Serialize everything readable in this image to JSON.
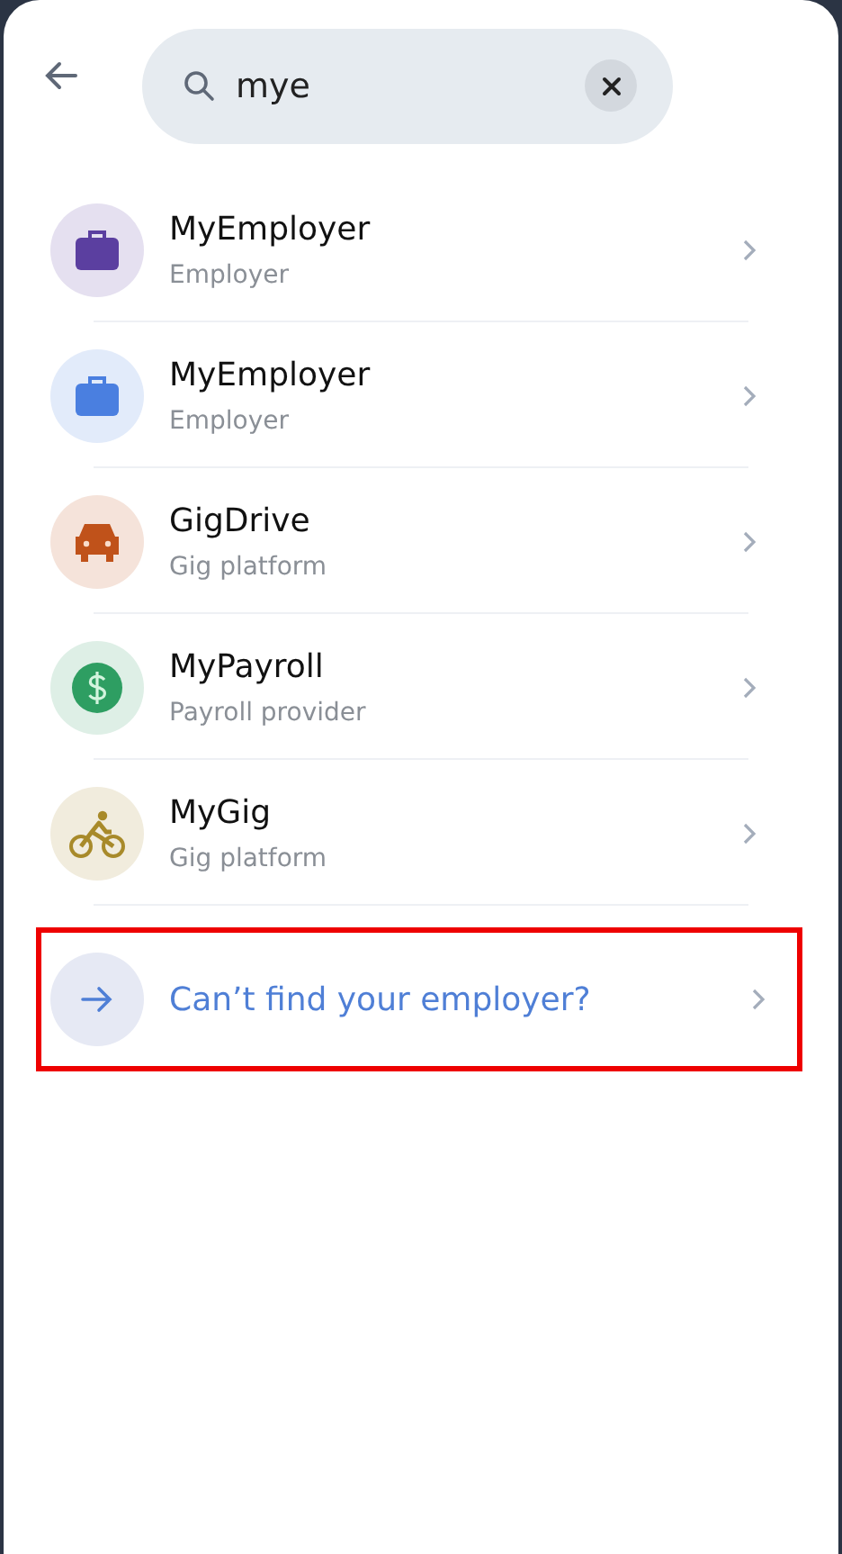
{
  "search": {
    "value": "mye"
  },
  "results": [
    {
      "kind": "briefcase",
      "name": "MyEmployer",
      "type": "Employer",
      "color": "#5b3fa0"
    },
    {
      "kind": "briefcase",
      "name": "MyEmployer",
      "type": "Employer",
      "color": "#4a7fe0"
    },
    {
      "kind": "car",
      "name": "GigDrive",
      "type": "Gig platform",
      "color": "#c0521a"
    },
    {
      "kind": "dollar",
      "name": "MyPayroll",
      "type": "Payroll provider",
      "color": "#2e9e62"
    },
    {
      "kind": "bike",
      "name": "MyGig",
      "type": "Gig platform",
      "color": "#a88a2a"
    }
  ],
  "footer": {
    "label": "Can’t find your employer?",
    "highlighted": true
  }
}
